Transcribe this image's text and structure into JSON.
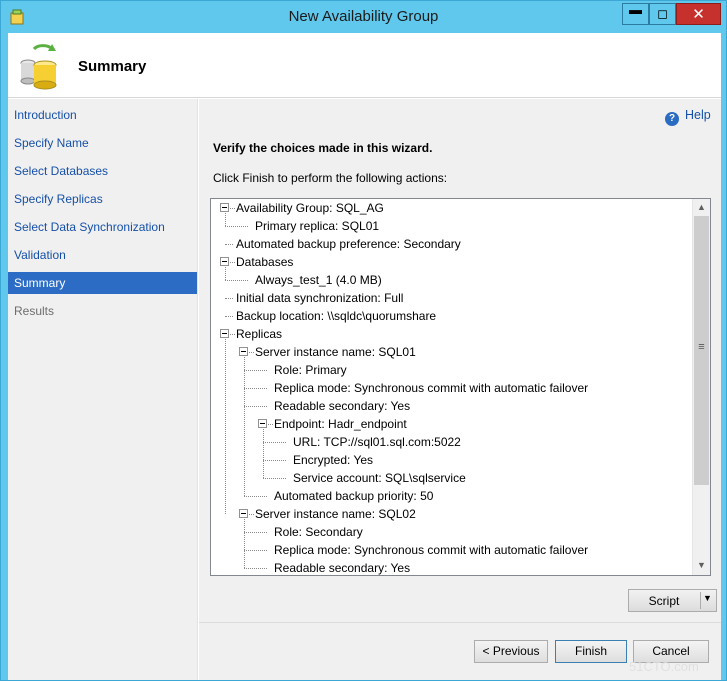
{
  "window": {
    "title": "New Availability Group",
    "controls": {
      "minimize": "▬",
      "maximize": "◻",
      "close": "✕"
    },
    "accent_color": "#5fc8ec"
  },
  "header": {
    "title": "Summary",
    "icon": "database-sync-icon"
  },
  "nav": {
    "items": [
      {
        "label": "Introduction",
        "state": "normal"
      },
      {
        "label": "Specify Name",
        "state": "normal"
      },
      {
        "label": "Select Databases",
        "state": "normal"
      },
      {
        "label": "Specify Replicas",
        "state": "normal"
      },
      {
        "label": "Select Data Synchronization",
        "state": "normal"
      },
      {
        "label": "Validation",
        "state": "normal"
      },
      {
        "label": "Summary",
        "state": "active"
      },
      {
        "label": "Results",
        "state": "disabled"
      }
    ]
  },
  "main": {
    "help_label": "Help",
    "heading": "Verify the choices made in this wizard.",
    "subheading": "Click Finish to perform the following actions:",
    "tree": [
      {
        "text": "Availability Group: SQL_AG",
        "level": 0,
        "expanded": true
      },
      {
        "text": "Primary replica: SQL01",
        "level": 1
      },
      {
        "text": "Automated backup preference: Secondary",
        "level": 0
      },
      {
        "text": "Databases",
        "level": 0,
        "expanded": true
      },
      {
        "text": "Always_test_1 (4.0 MB)",
        "level": 1
      },
      {
        "text": "Initial data synchronization: Full",
        "level": 0
      },
      {
        "text": "Backup location: \\\\sqldc\\quorumshare",
        "level": 0
      },
      {
        "text": "Replicas",
        "level": 0,
        "expanded": true
      },
      {
        "text": "Server instance name: SQL01",
        "level": 1,
        "expanded": true
      },
      {
        "text": "Role: Primary",
        "level": 2
      },
      {
        "text": "Replica mode: Synchronous commit with automatic failover",
        "level": 2
      },
      {
        "text": "Readable secondary: Yes",
        "level": 2
      },
      {
        "text": "Endpoint: Hadr_endpoint",
        "level": 2,
        "expanded": true
      },
      {
        "text": "URL: TCP://sql01.sql.com:5022",
        "level": 3
      },
      {
        "text": "Encrypted: Yes",
        "level": 3
      },
      {
        "text": "Service account: SQL\\sqlservice",
        "level": 3
      },
      {
        "text": "Automated backup priority: 50",
        "level": 2
      },
      {
        "text": "Server instance name: SQL02",
        "level": 1,
        "expanded": true
      },
      {
        "text": "Role: Secondary",
        "level": 2
      },
      {
        "text": "Replica mode: Synchronous commit with automatic failover",
        "level": 2
      },
      {
        "text": "Readable secondary: Yes",
        "level": 2
      }
    ],
    "script_label": "Script"
  },
  "buttons": {
    "previous": "< Previous",
    "finish": "Finish",
    "cancel": "Cancel"
  },
  "watermark": "51CTO.com"
}
